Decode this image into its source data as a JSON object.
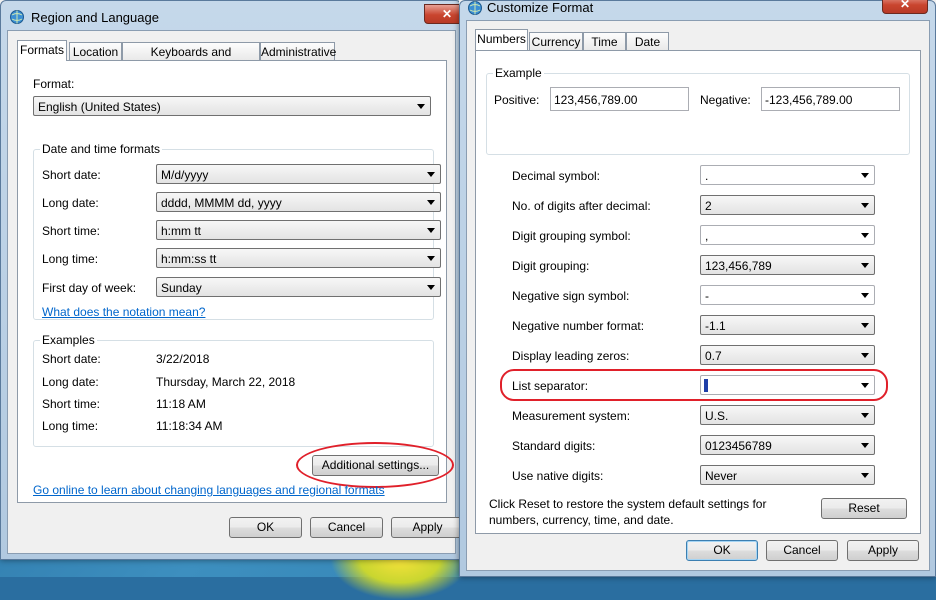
{
  "left": {
    "title": "Region and Language",
    "close": "✕",
    "tabs": [
      "Formats",
      "Location",
      "Keyboards and Languages",
      "Administrative"
    ],
    "format_label": "Format:",
    "format_value": "English (United States)",
    "dt_legend": "Date and time formats",
    "rows": [
      {
        "label": "Short date:",
        "value": "M/d/yyyy"
      },
      {
        "label": "Long date:",
        "value": "dddd, MMMM dd, yyyy"
      },
      {
        "label": "Short time:",
        "value": "h:mm tt"
      },
      {
        "label": "Long time:",
        "value": "h:mm:ss tt"
      },
      {
        "label": "First day of week:",
        "value": "Sunday"
      }
    ],
    "notation_link": "What does the notation mean?",
    "examples_legend": "Examples",
    "examples": [
      {
        "label": "Short date:",
        "value": "3/22/2018"
      },
      {
        "label": "Long date:",
        "value": "Thursday, March 22, 2018"
      },
      {
        "label": "Short time:",
        "value": "11:18 AM"
      },
      {
        "label": "Long time:",
        "value": "11:18:34 AM"
      }
    ],
    "additional_btn": "Additional settings...",
    "online_link": "Go online to learn about changing languages and regional formats",
    "ok": "OK",
    "cancel": "Cancel",
    "apply": "Apply"
  },
  "right": {
    "title": "Customize Format",
    "close": "✕",
    "tabs": [
      "Numbers",
      "Currency",
      "Time",
      "Date"
    ],
    "example_legend": "Example",
    "positive_label": "Positive:",
    "positive_value": "123,456,789.00",
    "negative_label": "Negative:",
    "negative_value": "-123,456,789.00",
    "settings": [
      {
        "label": "Decimal symbol:",
        "value": "."
      },
      {
        "label": "No. of digits after decimal:",
        "value": "2"
      },
      {
        "label": "Digit grouping symbol:",
        "value": ","
      },
      {
        "label": "Digit grouping:",
        "value": "123,456,789"
      },
      {
        "label": "Negative sign symbol:",
        "value": "-"
      },
      {
        "label": "Negative number format:",
        "value": "-1.1"
      },
      {
        "label": "Display leading zeros:",
        "value": "0.7"
      },
      {
        "label": "List separator:",
        "value": ""
      },
      {
        "label": "Measurement system:",
        "value": "U.S."
      },
      {
        "label": "Standard digits:",
        "value": "0123456789"
      },
      {
        "label": "Use native digits:",
        "value": "Never"
      }
    ],
    "reset_note_1": "Click Reset to restore the system default settings for",
    "reset_note_2": "numbers, currency, time, and date.",
    "reset": "Reset",
    "ok": "OK",
    "cancel": "Cancel",
    "apply": "Apply"
  },
  "colors": {
    "highlight": "#e0202a",
    "link": "#0066cc"
  }
}
